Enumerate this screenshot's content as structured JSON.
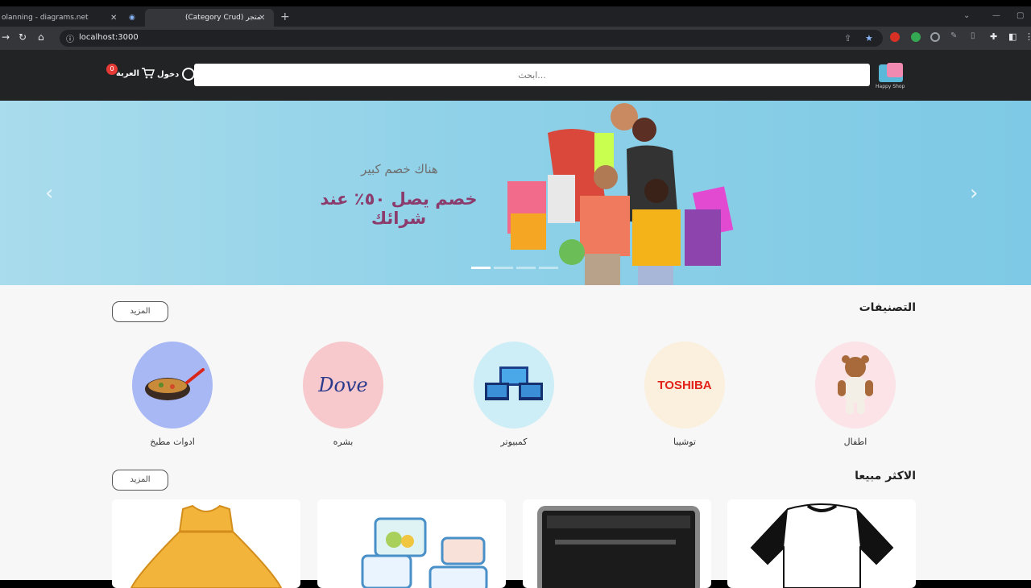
{
  "browser": {
    "tabs": [
      {
        "title": "olanning - diagrams.net"
      },
      {
        "title": "(Category Crud) متجر"
      }
    ],
    "url": "localhost:3000"
  },
  "header": {
    "logo_text": "Happy Shop",
    "search_placeholder": "ابحث...",
    "login_label": "دخول",
    "cart_label": "العربة",
    "cart_count": "0"
  },
  "banner": {
    "subtitle": "هناك خصم كبير",
    "headline": "خصم يصل ٥٠٪ عند شرائك",
    "slides": 4,
    "active_slide": 1
  },
  "categories_section": {
    "title": "التصنيفات",
    "more_label": "المزيد",
    "items": [
      {
        "label": "اطفال",
        "color": "#fbe3e8"
      },
      {
        "label": "توشيبا",
        "color": "#fbefdd",
        "logo_text": "TOSHIBA"
      },
      {
        "label": "كمبيوتر",
        "color": "#cdeef6"
      },
      {
        "label": "بشره",
        "color": "#f8c9cc",
        "logo_text": "Dove"
      },
      {
        "label": "ادوات مطبخ",
        "color": "#a8b8f5"
      }
    ]
  },
  "bestsellers_section": {
    "title": "الاكثر مبيعا",
    "more_label": "المزيد"
  },
  "colors": {
    "header_bg": "#222325",
    "banner_headline": "#8b3b6c",
    "badge": "#e53935"
  }
}
